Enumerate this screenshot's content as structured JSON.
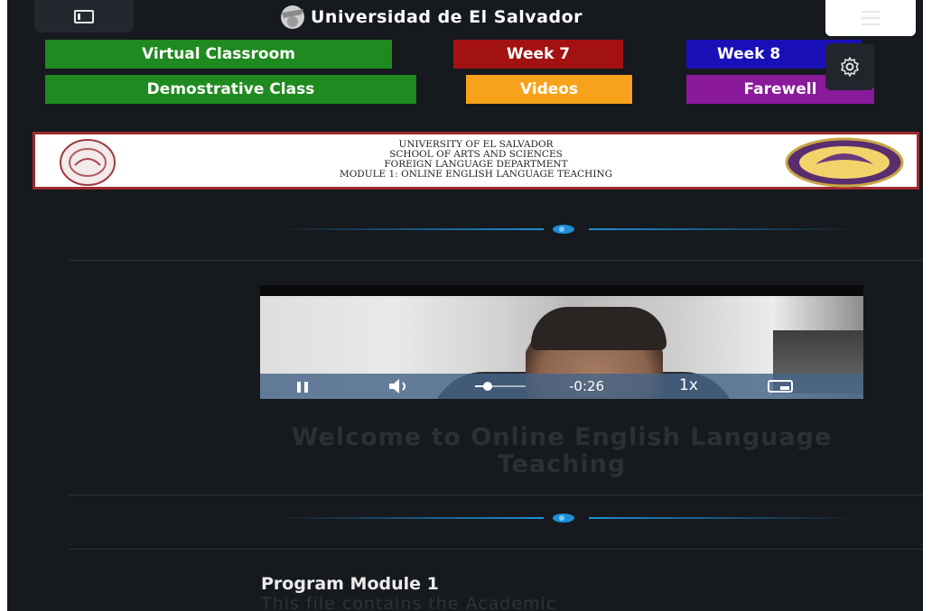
{
  "header": {
    "title": "Universidad de El Salvador",
    "sidebar_toggle_icon": "sidebar-toggle-icon",
    "menu_icon": "hamburger-menu-icon"
  },
  "nav": {
    "buttons": [
      {
        "label": "Virtual Classroom",
        "color": "#1f8a1f"
      },
      {
        "label": "Week 7",
        "color": "#a31212"
      },
      {
        "label": "Week 8",
        "color": "#1a10b8"
      },
      {
        "label": "Demostrative Class",
        "color": "#1f8a1f"
      },
      {
        "label": "Videos",
        "color": "#f6a21a"
      },
      {
        "label": "Farewell",
        "color": "#8a1a99"
      }
    ],
    "settings_icon": "gear-icon"
  },
  "banner": {
    "lines": [
      "UNIVERSITY OF EL SALVADOR",
      "SCHOOL OF ARTS AND SCIENCES",
      "FOREIGN LANGUAGE DEPARTMENT",
      "MODULE 1:  ONLINE ENGLISH LANGUAGE TEACHING"
    ]
  },
  "video": {
    "time_remaining": "-0:26",
    "speed": "1x",
    "volume_level": 0.25,
    "state": "playing"
  },
  "content": {
    "welcome_heading": "Welcome to Online English Language Teaching",
    "module_title": "Program Module 1",
    "module_description": "This file contains the Academic"
  },
  "colors": {
    "background": "#16191d",
    "accent": "#1e8fd8"
  }
}
